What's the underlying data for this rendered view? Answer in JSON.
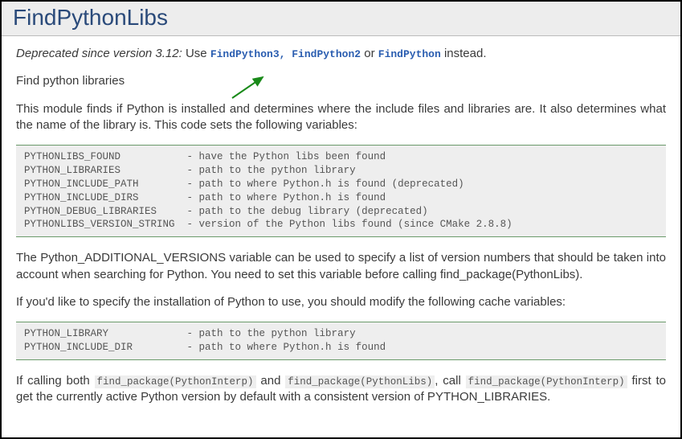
{
  "title": "FindPythonLibs",
  "deprecated": {
    "label": "Deprecated since version 3.12:",
    "prefix": "Use ",
    "link1": "FindPython3",
    "sep1": ", ",
    "link2": "FindPython2",
    "mid": " or ",
    "link3": "FindPython",
    "suffix": " instead."
  },
  "intro": "Find python libraries",
  "desc1": "This module finds if Python is installed and determines where the include files and libraries are. It also determines what the name of the library is. This code sets the following variables:",
  "vars1_block": "PYTHONLIBS_FOUND           - have the Python libs been found\nPYTHON_LIBRARIES           - path to the python library\nPYTHON_INCLUDE_PATH        - path to where Python.h is found (deprecated)\nPYTHON_INCLUDE_DIRS        - path to where Python.h is found\nPYTHON_DEBUG_LIBRARIES     - path to the debug library (deprecated)\nPYTHONLIBS_VERSION_STRING  - version of the Python libs found (since CMake 2.8.8)",
  "desc2": "The Python_ADDITIONAL_VERSIONS variable can be used to specify a list of version numbers that should be taken into account when searching for Python. You need to set this variable before calling find_package(PythonLibs).",
  "desc3": "If you'd like to specify the installation of Python to use, you should modify the following cache variables:",
  "vars2_block": "PYTHON_LIBRARY             - path to the python library\nPYTHON_INCLUDE_DIR         - path to where Python.h is found",
  "final": {
    "t1": "If calling both ",
    "c1": "find_package(PythonInterp)",
    "t2": " and ",
    "c2": "find_package(PythonLibs)",
    "t3": ", call ",
    "c3": "find_package(PythonInterp)",
    "t4": " first to get the currently active Python version by default with a consistent version of PYTHON_LIBRARIES."
  }
}
